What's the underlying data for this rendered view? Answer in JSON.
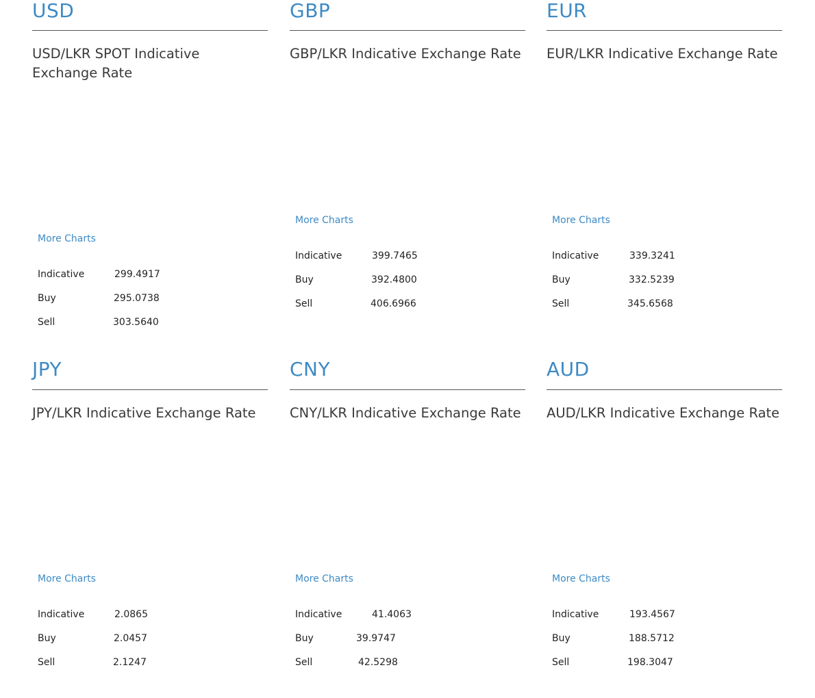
{
  "cards": [
    {
      "code": "USD",
      "title": "USD/LKR SPOT Indicative Exchange Rate",
      "more_label": "More Charts",
      "rates": [
        {
          "label": "Indicative",
          "value": "299.4917"
        },
        {
          "label": "Buy",
          "value": "295.0738"
        },
        {
          "label": "Sell",
          "value": "303.5640"
        }
      ]
    },
    {
      "code": "GBP",
      "title": "GBP/LKR Indicative Exchange Rate",
      "more_label": "More Charts",
      "rates": [
        {
          "label": "Indicative",
          "value": "399.7465"
        },
        {
          "label": "Buy",
          "value": "392.4800"
        },
        {
          "label": "Sell",
          "value": "406.6966"
        }
      ]
    },
    {
      "code": "EUR",
      "title": "EUR/LKR Indicative Exchange Rate",
      "more_label": "More Charts",
      "rates": [
        {
          "label": "Indicative",
          "value": "339.3241"
        },
        {
          "label": "Buy",
          "value": "332.5239"
        },
        {
          "label": "Sell",
          "value": "345.6568"
        }
      ]
    },
    {
      "code": "JPY",
      "title": "JPY/LKR Indicative Exchange Rate",
      "more_label": "More Charts",
      "rates": [
        {
          "label": "Indicative",
          "value": "2.0865"
        },
        {
          "label": "Buy",
          "value": "2.0457"
        },
        {
          "label": "Sell",
          "value": "2.1247"
        }
      ]
    },
    {
      "code": "CNY",
      "title": "CNY/LKR Indicative Exchange Rate",
      "more_label": "More Charts",
      "rates": [
        {
          "label": "Indicative",
          "value": "41.4063"
        },
        {
          "label": "Buy",
          "value": "39.9747"
        },
        {
          "label": "Sell",
          "value": "42.5298"
        }
      ]
    },
    {
      "code": "AUD",
      "title": "AUD/LKR Indicative Exchange Rate",
      "more_label": "More Charts",
      "rates": [
        {
          "label": "Indicative",
          "value": "193.4567"
        },
        {
          "label": "Buy",
          "value": "188.5712"
        },
        {
          "label": "Sell",
          "value": "198.3047"
        }
      ]
    }
  ]
}
